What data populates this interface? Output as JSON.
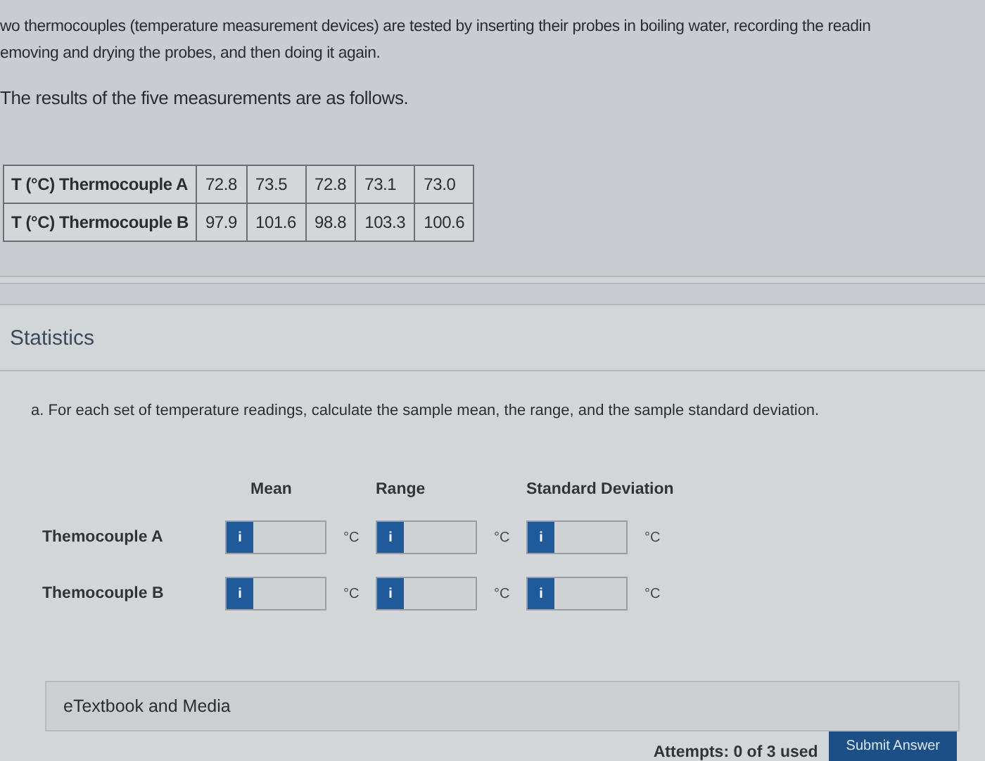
{
  "intro": [
    "wo thermocouples (temperature measurement devices) are tested by inserting their probes in boiling water, recording the readin",
    "emoving and drying the probes, and then doing it again."
  ],
  "results_text": "The results of the five measurements are as follows.",
  "table": {
    "rows": [
      {
        "label": "T (°C) Thermocouple A",
        "values": [
          "72.8",
          "73.5",
          "72.8",
          "73.1",
          "73.0"
        ]
      },
      {
        "label": "T (°C) Thermocouple B",
        "values": [
          "97.9",
          "101.6",
          "98.8",
          "103.3",
          "100.6"
        ]
      }
    ]
  },
  "section_title": "Statistics",
  "question": "a. For each set of temperature readings, calculate the sample mean, the range, and the sample standard deviation.",
  "answer_grid": {
    "columns": [
      "Mean",
      "Range",
      "Standard Deviation"
    ],
    "rows": [
      {
        "label": "Themocouple A",
        "fields": [
          {
            "info": "i",
            "unit": "°C"
          },
          {
            "info": "i",
            "unit": "°C"
          },
          {
            "info": "i",
            "unit": "°C"
          }
        ]
      },
      {
        "label": "Themocouple B",
        "fields": [
          {
            "info": "i",
            "unit": "°C"
          },
          {
            "info": "i",
            "unit": "°C"
          },
          {
            "info": "i",
            "unit": "°C"
          }
        ]
      }
    ]
  },
  "etextbook": "eTextbook and Media",
  "attempts": "Attempts: 0 of 3 used",
  "submit": "Submit Answer"
}
